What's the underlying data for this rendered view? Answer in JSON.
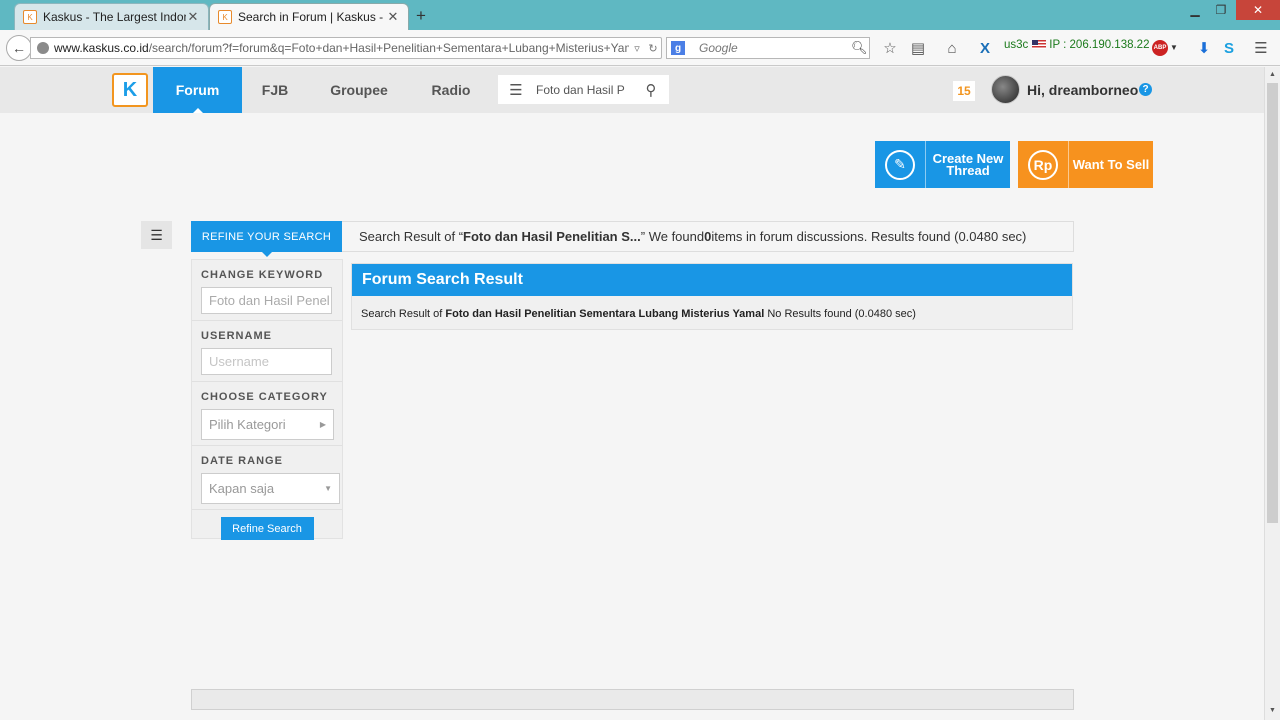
{
  "browser": {
    "tabs": [
      {
        "title": "Kaskus - The Largest Indon...",
        "close": "✕"
      },
      {
        "title": "Search in Forum | Kaskus - ...",
        "close": "✕"
      }
    ],
    "new_tab": "+",
    "url_host": "www.kaskus.co.id",
    "url_path": "/search/forum?f=forum&q=Foto+dan+Hasil+Penelitian+Sementara+Lubang+Misterius+Yamal",
    "search_engine_placeholder": "Google",
    "ip_label": "us3c",
    "ip_text": "IP : 206.190.138.22",
    "abp_label": "ABP"
  },
  "site": {
    "nav": [
      "Forum",
      "FJB",
      "Groupee",
      "Radio"
    ],
    "header_search_value": "Foto dan Hasil P",
    "notification_count": "15",
    "greeting": "Hi, dreamborneo",
    "create_thread_label1": "Create New",
    "create_thread_label2": "Thread",
    "want_to_sell_label": "Want To Sell",
    "sell_icon_text": "Rp"
  },
  "refine": {
    "tab_label": "REFINE YOUR SEARCH",
    "keyword_label": "CHANGE KEYWORD",
    "keyword_value": "Foto dan Hasil Penel",
    "username_label": "USERNAME",
    "username_placeholder": "Username",
    "category_label": "CHOOSE CATEGORY",
    "category_value": "Pilih Kategori",
    "date_label": "DATE RANGE",
    "date_value": "Kapan saja",
    "button": "Refine Search"
  },
  "summary": {
    "prefix": "Search Result of “",
    "query": "Foto dan Hasil Penelitian S...",
    "mid": "” We found ",
    "count": "0",
    "suffix": " items in forum discussions. Results found (0.0480 sec)"
  },
  "results": {
    "title": "Forum Search Result",
    "prefix": "Search Result of ",
    "query": "Foto dan Hasil Penelitian Sementara Lubang Misterius Yamal",
    "suffix": " No Results found (0.0480 sec)"
  }
}
